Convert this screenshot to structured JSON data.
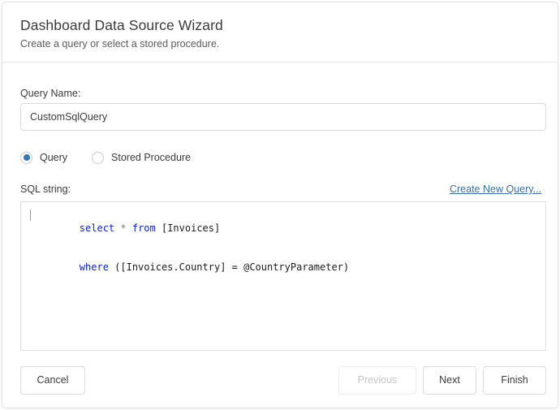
{
  "dialog": {
    "title": "Dashboard Data Source Wizard",
    "subtitle": "Create a query or select a stored procedure."
  },
  "form": {
    "query_name_label": "Query Name:",
    "query_name_value": "CustomSqlQuery",
    "query_name_placeholder": "",
    "mode_options": [
      {
        "label": "Query",
        "selected": true
      },
      {
        "label": "Stored Procedure",
        "selected": false
      }
    ],
    "sql_string_label": "SQL string:",
    "create_new_query_link": "Create New Query...",
    "sql": {
      "line1": {
        "kw1": "select",
        "star": " * ",
        "kw2": "from",
        "rest": " [Invoices]"
      },
      "line2": {
        "kw1": "where",
        "rest": " ([Invoices.Country] = @CountryParameter)"
      }
    }
  },
  "footer": {
    "cancel_label": "Cancel",
    "previous_label": "Previous",
    "next_label": "Next",
    "finish_label": "Finish"
  },
  "colors": {
    "accent": "#3079bf",
    "link": "#3c6fa8",
    "keyword": "#0b21d8",
    "text": "#3b3b3b",
    "disabled": "#c4c4c4"
  }
}
